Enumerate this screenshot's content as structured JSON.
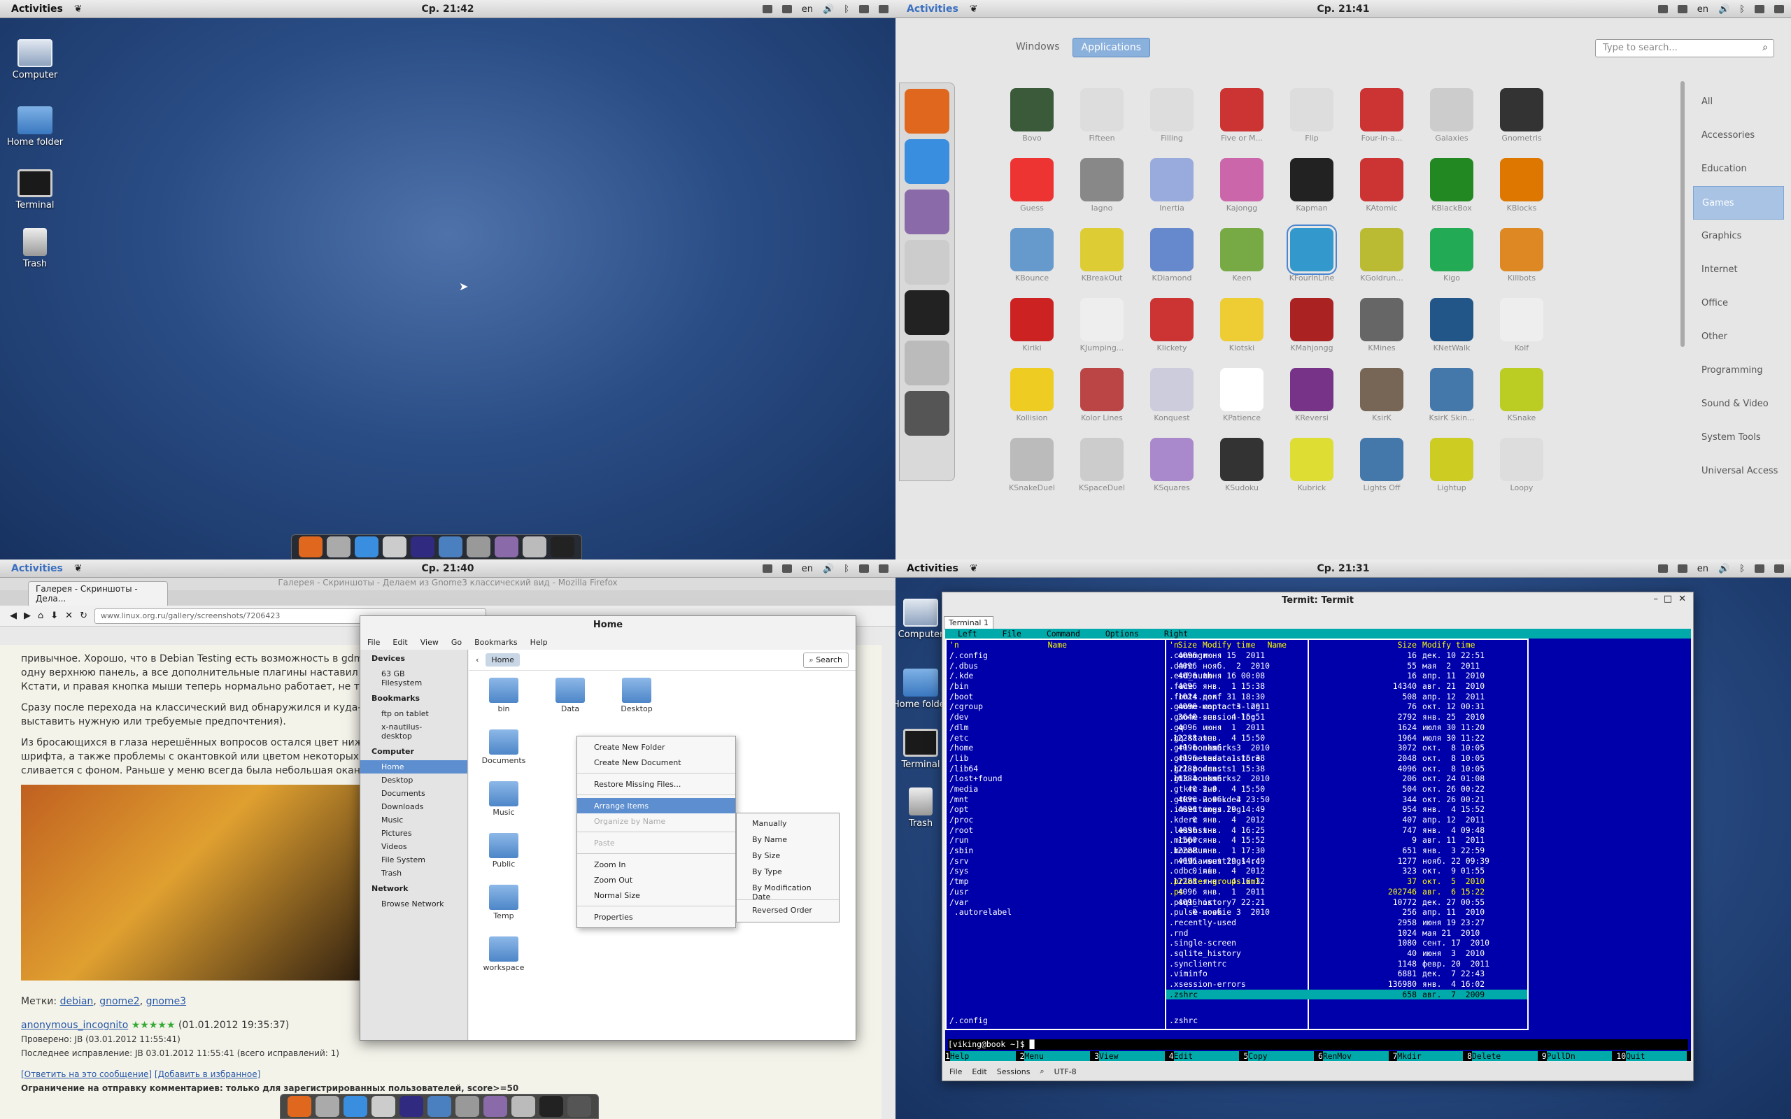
{
  "q1": {
    "activities": "Activities",
    "clock": "Ср. 21:42",
    "lang": "en",
    "desktop_icons": [
      {
        "label": "Computer"
      },
      {
        "label": "Home folder"
      },
      {
        "label": "Terminal"
      },
      {
        "label": "Trash"
      }
    ]
  },
  "q2": {
    "activities": "Activities",
    "clock": "Ср. 21:41",
    "lang": "en",
    "tabs": [
      "Windows",
      "Applications"
    ],
    "search_placeholder": "Type to search...",
    "apps": [
      "Bovo",
      "Fifteen",
      "Filling",
      "Five or M...",
      "Flip",
      "Four-in-a...",
      "Galaxies",
      "Gnometris",
      "Guess",
      "Iagno",
      "Inertia",
      "Kajongg",
      "Kapman",
      "KAtomic",
      "KBlackBox",
      "KBlocks",
      "KBounce",
      "KBreakOut",
      "KDiamond",
      "Keen",
      "KFourInLine",
      "KGoldrun...",
      "Kigo",
      "Killbots",
      "Kiriki",
      "KJumping...",
      "Klickety",
      "Klotski",
      "KMahjongg",
      "KMines",
      "KNetWalk",
      "Kolf",
      "Kollision",
      "Kolor Lines",
      "Konquest",
      "KPatience",
      "KReversi",
      "KsirK",
      "KsirK Skin...",
      "KSnake",
      "KSnakeDuel",
      "KSpaceDuel",
      "KSquares",
      "KSudoku",
      "Kubrick",
      "Lights Off",
      "Lightup",
      "Loopy"
    ],
    "categories": [
      "All",
      "Accessories",
      "Education",
      "Games",
      "Graphics",
      "Internet",
      "Office",
      "Other",
      "Programming",
      "Sound & Video",
      "System Tools",
      "Universal Access"
    ]
  },
  "q3": {
    "activities": "Activities",
    "clock": "Ср. 21:40",
    "lang": "en",
    "ff_title": "Галерея - Скриншоты - Делаем из Gnome3 классический вид - Mozilla Firefox",
    "ff_tab": "Галерея - Скриншоты - Дела...",
    "url": "www.linux.org.ru/gallery/screenshots/7206423",
    "p1": "привычное. Хорошо, что в Debian Testing есть возможность в gdm3 п",
    "p2": "одну верхнюю панель, а все дополнительные плагины наставил на н",
    "p3": "Кстати, и правая кнопка мыши теперь нормально работает, не треб",
    "p4": "Сразу после перехода на классический вид обнаружился и куда-то п",
    "p5": "выставить нужную или требуемые предпочтения).",
    "p6": "Из бросающихся в глаза нерешённых вопросов остался цвет нижней",
    "p7": "шрифта, а также проблемы с окантовкой или цветом некоторых мен",
    "p8": "сливается с фоном. Раньше у меню всегда была небольшая окантов",
    "tags_label": "Метки:",
    "tags": [
      "debian",
      "gnome2",
      "gnome3"
    ],
    "author": "anonymous_incognito",
    "date": "(01.01.2012 19:35:37)",
    "checked": "Проверено: JB (03.01.2012 11:55:41)",
    "fix": "Последнее исправление: JB 03.01.2012 11:55:41 (всего исправлений: 1)",
    "reply": "[Ответить на это сообщение]",
    "fav": "[Добавить в избранное]",
    "restrict": "Ограничение на отправку комментариев: только для зарегистрированных пользователей, score>=50",
    "nautilus": {
      "title": "Home",
      "menu": [
        "File",
        "Edit",
        "View",
        "Go",
        "Bookmarks",
        "Help"
      ],
      "devices_h": "Devices",
      "devices": [
        "63 GB Filesystem"
      ],
      "bookmarks_h": "Bookmarks",
      "bookmarks": [
        "ftp on tablet",
        "x-nautilus-desktop"
      ],
      "computer_h": "Computer",
      "computer": [
        "Home",
        "Desktop",
        "Documents",
        "Downloads",
        "Music",
        "Pictures",
        "Videos",
        "File System",
        "Trash"
      ],
      "network_h": "Network",
      "network": [
        "Browse Network"
      ],
      "crumb": "Home",
      "search": "Search",
      "folders": [
        "bin",
        "Data",
        "Desktop",
        "Documents",
        "Music",
        "Public",
        "Temp",
        "workspace"
      ]
    },
    "context_menu": [
      "Create New Folder",
      "Create New Document",
      "Restore Missing Files...",
      "Arrange Items",
      "Organize by Name",
      "Paste",
      "Zoom In",
      "Zoom Out",
      "Normal Size",
      "Properties"
    ],
    "sub_menu": [
      "Manually",
      "By Name",
      "By Size",
      "By Type",
      "By Modification Date",
      "Reversed Order"
    ]
  },
  "q4": {
    "activities": "Activities",
    "clock": "Ср. 21:31",
    "lang": "en",
    "desktop_icons": [
      {
        "label": "Computer"
      },
      {
        "label": "Home folder"
      },
      {
        "label": "Terminal"
      },
      {
        "label": "Trash"
      }
    ],
    "term_title": "Termit: Termit",
    "term_tab": "Terminal 1",
    "mc_menu": [
      "Left",
      "File",
      "Command",
      "Options",
      "Right"
    ],
    "col_n": "'n",
    "col_name": "Name",
    "col_size": "Size",
    "col_time": "Modify time",
    "left_rows": [
      [
        "/.config",
        "4096",
        "июня 15  2011"
      ],
      [
        "/.dbus",
        "4096",
        "нояб.  2  2010"
      ],
      [
        "/.kde",
        "4096",
        "июня 16 00:08"
      ],
      [
        "/bin",
        "4096",
        "янв.  1 15:38"
      ],
      [
        "/boot",
        "1024",
        "дек. 31 18:30"
      ],
      [
        "/cgroup",
        "4096",
        "марта  3  2011"
      ],
      [
        "/dev",
        "3640",
        "янв.  4 15:51"
      ],
      [
        "/dlm",
        "4096",
        "июня  1  2011"
      ],
      [
        "/etc",
        "12288",
        "янв.  4 15:50"
      ],
      [
        "/home",
        "4096",
        "нояб.  3  2010"
      ],
      [
        "/lib",
        "4096",
        "янв.  1 15:38"
      ],
      [
        "/lib64",
        "12288",
        "янв.  1 15:38"
      ],
      [
        "/lost+found",
        "16384",
        "нояб.  2  2010"
      ],
      [
        "/media",
        "40",
        "янв.  4 15:50"
      ],
      [
        "/mnt",
        "4096",
        "нояб.  3 23:50"
      ],
      [
        "/opt",
        "4096",
        "июня 29 14:49"
      ],
      [
        "/proc",
        "0",
        "янв.  4  2012"
      ],
      [
        "/root",
        "4096",
        "янв.  4 16:25"
      ],
      [
        "/run",
        "1560",
        "янв.  4 15:52"
      ],
      [
        "/sbin",
        "12288",
        "янв.  1 17:30"
      ],
      [
        "/srv",
        "4096",
        "июня 29 14:49"
      ],
      [
        "/sys",
        "0",
        "янв.  4  2012"
      ],
      [
        "/tmp",
        "12288",
        "янв.  4 16:32"
      ],
      [
        "/usr",
        "4096",
        "янв.  1  2011"
      ],
      [
        "/var",
        "4096",
        "окт.  7 22:21"
      ],
      [
        " .autorelabel",
        "0",
        "нояб.  3  2010"
      ]
    ],
    "right_rows": [
      [
        ".connmgr",
        "16",
        "дек. 10 22:51"
      ],
      [
        ".dmrc",
        "55",
        "мая  2  2011"
      ],
      [
        ".esd_auth",
        "16",
        "апр. 11  2010"
      ],
      [
        ".face",
        "14340",
        "авг. 21  2010"
      ],
      [
        ".fonts.conf",
        "508",
        "апр. 12  2011"
      ],
      [
        ".gnome-contacts-log",
        "76",
        "окт. 12 00:31"
      ],
      [
        ".gnome-session-log",
        "2792",
        "янв. 25  2010"
      ],
      [
        ".gq",
        "1624",
        "июля 30 11:20"
      ],
      [
        ".gq-state",
        "1964",
        "июля 30 11:22"
      ],
      [
        ".grl-bookmarks",
        "3072",
        "окт.  8 10:05"
      ],
      [
        ".grl-metadata-store",
        "2048",
        "окт.  8 10:05"
      ],
      [
        ".grl-podcasts",
        "4096",
        "окт.  8 10:05"
      ],
      [
        ".gtk-bookmarks",
        "206",
        "окт. 24 01:08"
      ],
      [
        ".gtkrc-2.0",
        "504",
        "окт. 26 00:22"
      ],
      [
        ".gtkrc-2.0-kde4",
        "344",
        "окт. 26 00:21"
      ],
      [
        ".imsettings.log",
        "954",
        "янв.  4 15:52"
      ],
      [
        ".kderc",
        "407",
        "апр. 12  2011"
      ],
      [
        ".lesshst",
        "747",
        "янв.  4 09:48"
      ],
      [
        ".mcoprc",
        "9",
        "авг. 11  2011"
      ],
      [
        ".monoRun",
        "651",
        "янв.  3 22:59"
      ],
      [
        ".nvidia-settings-rc",
        "1277",
        "нояб. 22 09:39"
      ],
      [
        ".odbc.ini",
        "323",
        "окт.  9 01:55"
      ],
      [
        ".printer-groups.xml",
        "37",
        "окт.  5  2010"
      ],
      [
        ".ps",
        "202746",
        "авг.  6 15:22"
      ],
      [
        ".psql_history",
        "10772",
        "дек. 27 00:55"
      ],
      [
        ".pulse-cookie",
        "256",
        "апр. 11  2010"
      ],
      [
        ".recently-used",
        "2958",
        "июня 19 23:27"
      ],
      [
        ".rnd",
        "1024",
        "мая 21  2010"
      ],
      [
        ".single-screen",
        "1080",
        "сент. 17  2010"
      ],
      [
        ".sqlite_history",
        "40",
        "июня  3  2010"
      ],
      [
        ".synclientrc",
        "1148",
        "февр. 20  2011"
      ],
      [
        ".viminfo",
        "6881",
        "дек.  7 22:43"
      ],
      [
        ".xsession-errors",
        "136980",
        "янв.  4 16:02"
      ],
      [
        ".zshrc",
        "658",
        "авг.  7  2009"
      ]
    ],
    "left_status": "/.config",
    "right_status": ".zshrc",
    "prompt": "[viking@book ~]$ ",
    "fkeys": [
      [
        "1",
        "Help"
      ],
      [
        "2",
        "Menu"
      ],
      [
        "3",
        "View"
      ],
      [
        "4",
        "Edit"
      ],
      [
        "5",
        "Copy"
      ],
      [
        "6",
        "RenMov"
      ],
      [
        "7",
        "Mkdir"
      ],
      [
        "8",
        "Delete"
      ],
      [
        "9",
        "PullDn"
      ],
      [
        "10",
        "Quit"
      ]
    ],
    "status_menu": [
      "File",
      "Edit",
      "Sessions"
    ],
    "encoding": "UTF-8"
  }
}
